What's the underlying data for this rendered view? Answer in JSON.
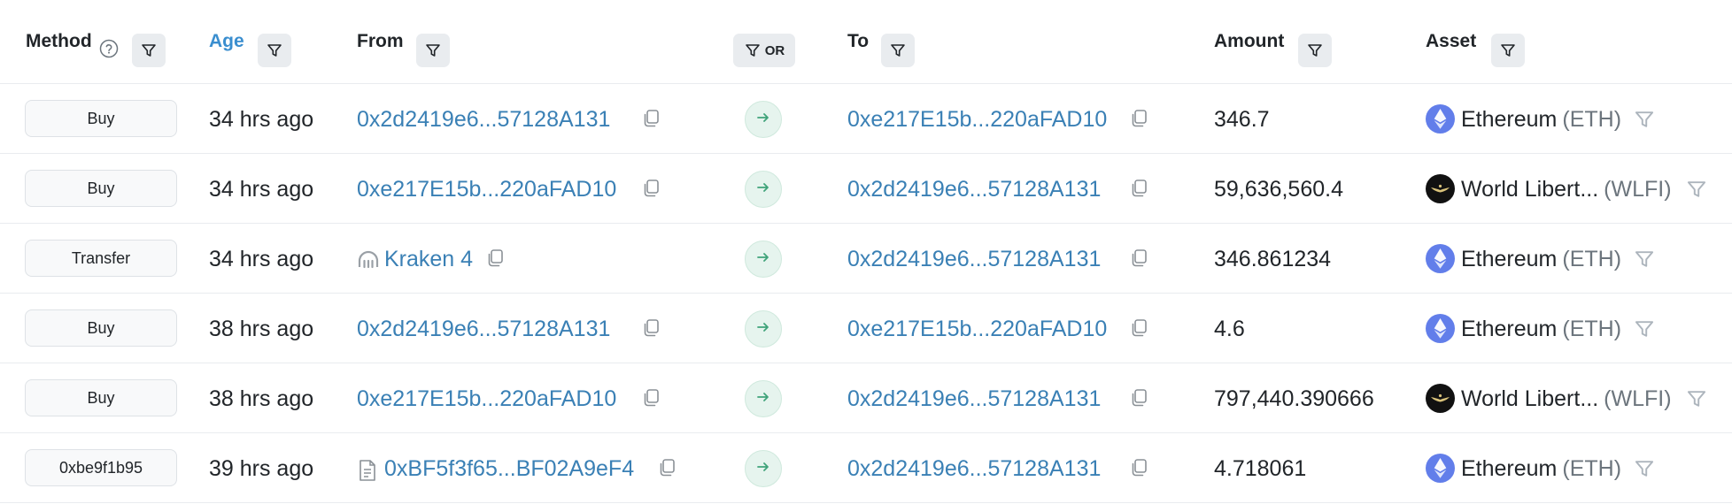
{
  "header": {
    "method": "Method",
    "age": "Age",
    "from": "From",
    "or": "OR",
    "to": "To",
    "amount": "Amount",
    "asset": "Asset"
  },
  "colors": {
    "link": "#3a80b5",
    "age_header": "#3a8ecf",
    "eth": "#627eea",
    "wlfi": "#111111",
    "arrow": "#3fa37a"
  },
  "rows": [
    {
      "method": "Buy",
      "age": "34 hrs ago",
      "from": "0x2d2419e6...57128A131",
      "from_icon": "",
      "to": "0xe217E15b...220aFAD10",
      "amount": "346.7",
      "asset_name": "Ethereum",
      "asset_symbol": "(ETH)",
      "asset_icon": "ethereum-icon"
    },
    {
      "method": "Buy",
      "age": "34 hrs ago",
      "from": "0xe217E15b...220aFAD10",
      "from_icon": "",
      "to": "0x2d2419e6...57128A131",
      "amount": "59,636,560.4",
      "asset_name": "World Libert...",
      "asset_symbol": "(WLFI)",
      "asset_icon": "wlfi-icon"
    },
    {
      "method": "Transfer",
      "age": "34 hrs ago",
      "from": "Kraken 4",
      "from_icon": "kraken-icon",
      "to": "0x2d2419e6...57128A131",
      "amount": "346.861234",
      "asset_name": "Ethereum",
      "asset_symbol": "(ETH)",
      "asset_icon": "ethereum-icon"
    },
    {
      "method": "Buy",
      "age": "38 hrs ago",
      "from": "0x2d2419e6...57128A131",
      "from_icon": "",
      "to": "0xe217E15b...220aFAD10",
      "amount": "4.6",
      "asset_name": "Ethereum",
      "asset_symbol": "(ETH)",
      "asset_icon": "ethereum-icon"
    },
    {
      "method": "Buy",
      "age": "38 hrs ago",
      "from": "0xe217E15b...220aFAD10",
      "from_icon": "",
      "to": "0x2d2419e6...57128A131",
      "amount": "797,440.390666",
      "asset_name": "World Libert...",
      "asset_symbol": "(WLFI)",
      "asset_icon": "wlfi-icon"
    },
    {
      "method": "0xbe9f1b95",
      "age": "39 hrs ago",
      "from": "0xBF5f3f65...BF02A9eF4",
      "from_icon": "contract-document-icon",
      "to": "0x2d2419e6...57128A131",
      "amount": "4.718061",
      "asset_name": "Ethereum",
      "asset_symbol": "(ETH)",
      "asset_icon": "ethereum-icon"
    }
  ]
}
